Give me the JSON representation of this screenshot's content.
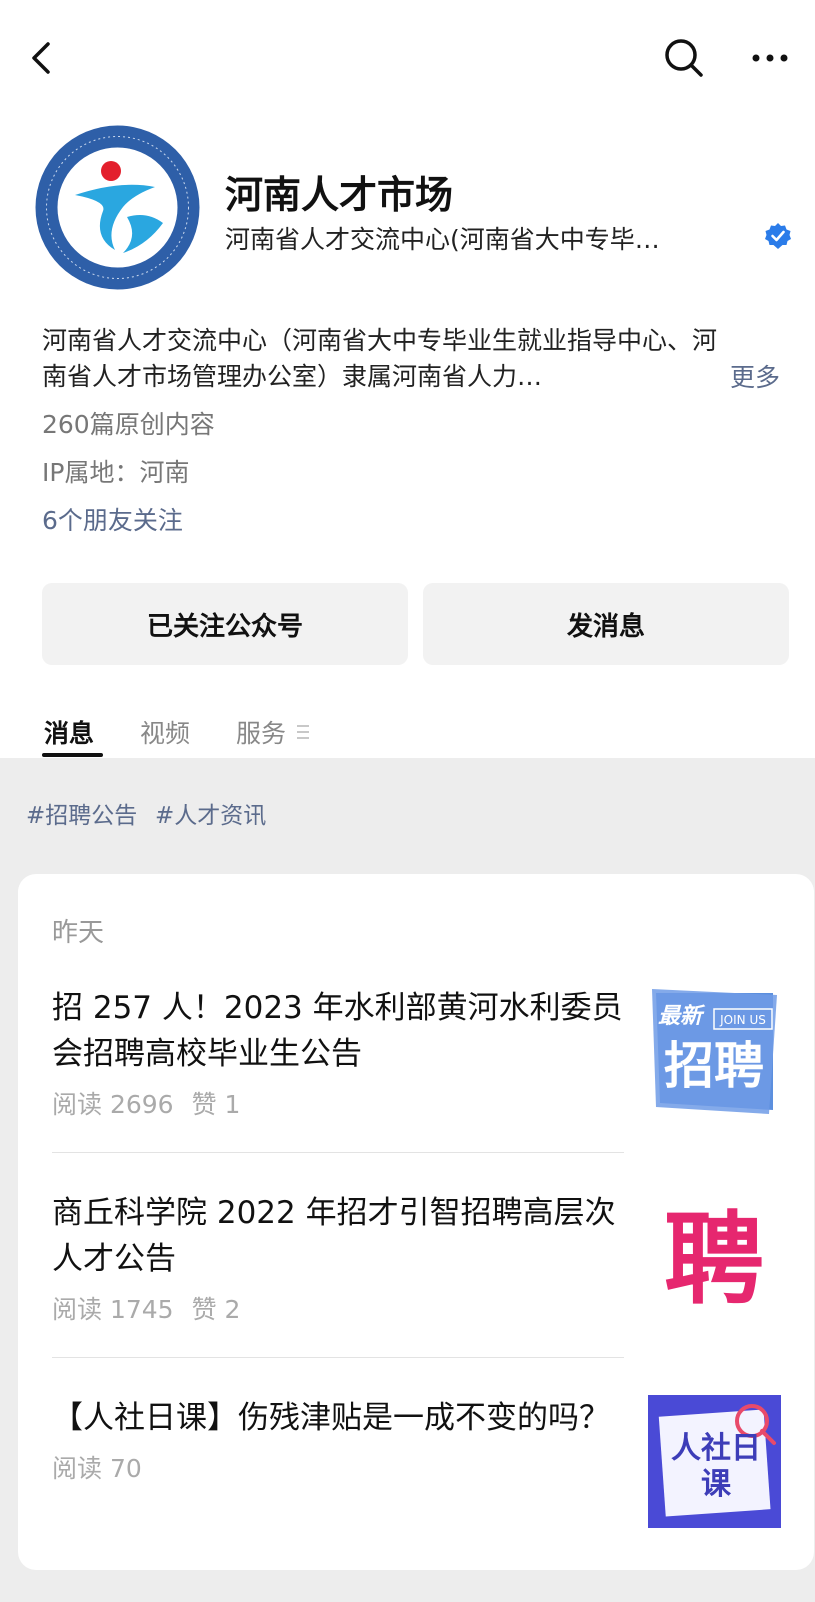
{
  "nav": {
    "back_icon": "chevron-left-icon",
    "search_icon": "search-icon",
    "more_icon": "more-dots-icon"
  },
  "profile": {
    "name": "河南人才市场",
    "org": "河南省人才交流中心(河南省大中专毕…",
    "verified_icon": "verified-badge-icon",
    "intro": "河南省人才交流中心（河南省大中专毕业生就业指导中心、河南省人才市场管理办公室）隶属河南省人力…",
    "intro_more": "更多",
    "original_count": "260篇原创内容",
    "ip_location": "IP属地：河南",
    "friends_follow": "6个朋友关注"
  },
  "actions": {
    "follow": "已关注公众号",
    "message": "发消息"
  },
  "tabs": [
    {
      "label": "消息",
      "active": true
    },
    {
      "label": "视频",
      "active": false
    },
    {
      "label": "服务",
      "active": false
    }
  ],
  "tags": [
    "#招聘公告",
    "#人才资讯"
  ],
  "feed": {
    "date": "昨天",
    "articles": [
      {
        "title": "招 257 人！2023 年水利部黄河水利委员会招聘高校毕业生公告",
        "reads": "阅读 2696",
        "likes": "赞 1",
        "thumb_text_top": "最新",
        "thumb_text_tag": "JOIN US",
        "thumb_text_main": "招聘"
      },
      {
        "title": "商丘科学院 2022 年招才引智招聘高层次人才公告",
        "reads": "阅读 1745",
        "likes": "赞 2",
        "thumb_text_main": "聘"
      },
      {
        "title": "【人社日课】伤残津贴是一成不变的吗？",
        "reads": "阅读 70",
        "likes": "",
        "thumb_text_main": "人社日课"
      }
    ]
  },
  "colors": {
    "accent_link": "#5b6b8c",
    "verified": "#2b7ce9",
    "feed_bg": "#ededed"
  }
}
